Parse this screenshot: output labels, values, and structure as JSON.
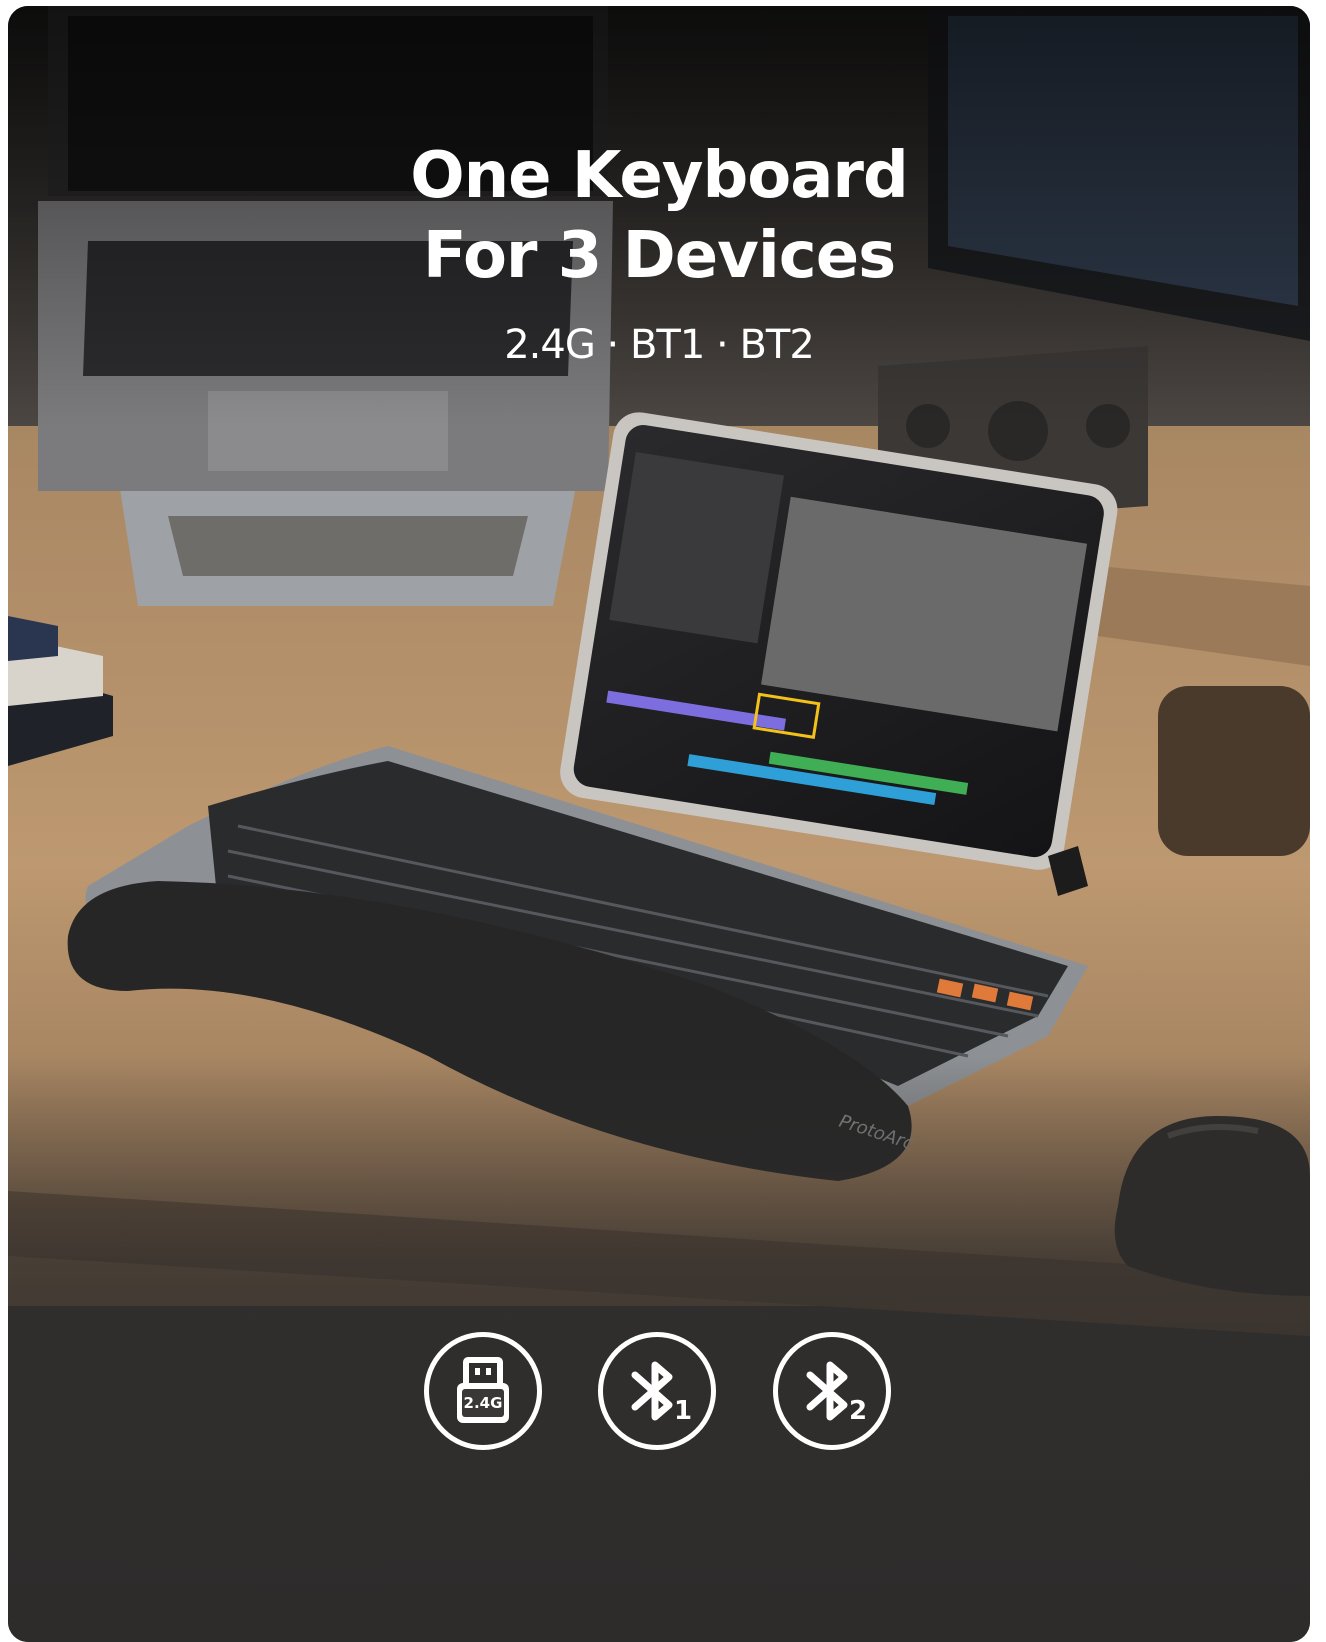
{
  "headline": {
    "line1": "One Keyboard",
    "line2": "For 3 Devices",
    "subtitle": "2.4G · BT1 · BT2"
  },
  "icons": [
    {
      "name": "usb-receiver-icon",
      "label": "2.4G"
    },
    {
      "name": "bluetooth-1-icon",
      "label": "1"
    },
    {
      "name": "bluetooth-2-icon",
      "label": "2"
    }
  ],
  "keyboard_brand": "ProtoArc",
  "colors": {
    "text": "#ffffff",
    "desk": "#b48e66",
    "background_dark": "#2f2d2c",
    "accent_keys": "#e07a3a"
  }
}
